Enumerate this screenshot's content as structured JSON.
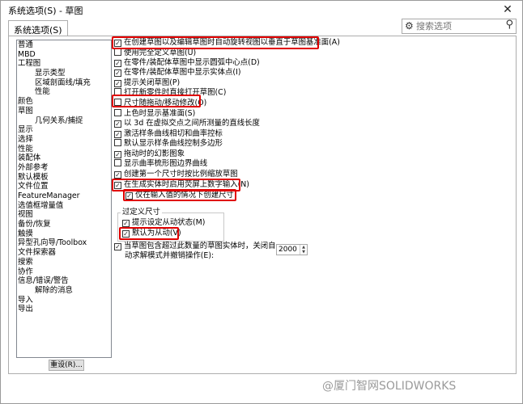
{
  "window": {
    "title": "系统选项(S) - 草图"
  },
  "tab": {
    "label": "系统选项(S)"
  },
  "search": {
    "placeholder": "搜索选项"
  },
  "nav": {
    "items": [
      {
        "label": "普通",
        "indent": 0
      },
      {
        "label": "MBD",
        "indent": 0
      },
      {
        "label": "工程图",
        "indent": 0
      },
      {
        "label": "显示类型",
        "indent": 1
      },
      {
        "label": "区域剖面线/填充",
        "indent": 1
      },
      {
        "label": "性能",
        "indent": 1
      },
      {
        "label": "颜色",
        "indent": 0
      },
      {
        "label": "草图",
        "indent": 0
      },
      {
        "label": "几何关系/捕捉",
        "indent": 1
      },
      {
        "label": "显示",
        "indent": 0
      },
      {
        "label": "选择",
        "indent": 0
      },
      {
        "label": "性能",
        "indent": 0
      },
      {
        "label": "装配体",
        "indent": 0
      },
      {
        "label": "外部参考",
        "indent": 0
      },
      {
        "label": "默认模板",
        "indent": 0
      },
      {
        "label": "文件位置",
        "indent": 0
      },
      {
        "label": "FeatureManager",
        "indent": 0
      },
      {
        "label": "选值框增量值",
        "indent": 0
      },
      {
        "label": "视图",
        "indent": 0
      },
      {
        "label": "备份/恢复",
        "indent": 0
      },
      {
        "label": "触摸",
        "indent": 0
      },
      {
        "label": "异型孔向导/Toolbox",
        "indent": 0
      },
      {
        "label": "文件探索器",
        "indent": 0
      },
      {
        "label": "搜索",
        "indent": 0
      },
      {
        "label": "协作",
        "indent": 0
      },
      {
        "label": "信息/错误/警告",
        "indent": 0
      },
      {
        "label": "解除的消息",
        "indent": 1
      },
      {
        "label": "导入",
        "indent": 0
      },
      {
        "label": "导出",
        "indent": 0
      }
    ],
    "reset_label": "重设(R)..."
  },
  "options": [
    {
      "label": "在创建草图以及编辑草图时自动旋转视图以垂直于草图基准面(A)",
      "checked": true
    },
    {
      "label": "使用完全定义草图(U)",
      "checked": false
    },
    {
      "label": "在零件/装配体草图中显示圆弧中心点(D)",
      "checked": true
    },
    {
      "label": "在零件/装配体草图中显示实体点(I)",
      "checked": true
    },
    {
      "label": "提示关闭草图(P)",
      "checked": true
    },
    {
      "label": "打开新零件时直接打开草图(C)",
      "checked": false
    },
    {
      "label": "尺寸随拖动/移动修改(O)",
      "checked": false
    },
    {
      "label": "上色时显示基准面(S)",
      "checked": false
    },
    {
      "label": "以 3d 在虚拟交点之间所测量的直线长度",
      "checked": true
    },
    {
      "label": "激活样条曲线相切和曲率控标",
      "checked": true
    },
    {
      "label": "默认显示样条曲线控制多边形",
      "checked": false
    },
    {
      "label": "拖动时的幻影图象",
      "checked": true
    },
    {
      "label": "显示曲率梳形图边界曲线",
      "checked": false
    },
    {
      "label": "创建第一个尺寸时按比例缩放草图",
      "checked": true
    },
    {
      "label": "在生成实体时启用荧屏上数字输入(N)",
      "checked": true
    },
    {
      "label": "仅在输入值的情况下创建尺寸",
      "checked": true
    }
  ],
  "overdefined": {
    "title": "过定义尺寸",
    "prompt_label": "提示设定从动状态(M)",
    "prompt_checked": true,
    "driven_label": "默认为从动(V)",
    "driven_checked": true
  },
  "undo": {
    "label_line1": "当草图包含超过此数量的草图实体时，关闭自",
    "label_line2": "动求解模式并撤销操作(E):",
    "checked": true,
    "value": "2000"
  },
  "watermark": "@厦门智网SOLIDWORKS",
  "colors": {
    "highlight": "#e00000"
  }
}
